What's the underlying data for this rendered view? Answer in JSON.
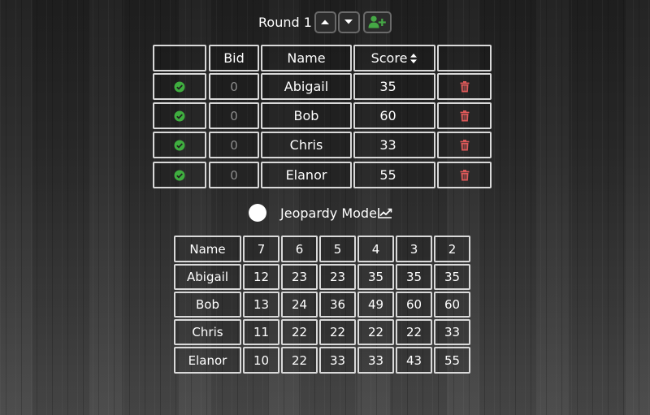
{
  "round": {
    "label": "Round 1"
  },
  "players_table": {
    "headers": {
      "check": "",
      "bid": "Bid",
      "name": "Name",
      "score": "Score",
      "delete": ""
    },
    "rows": [
      {
        "bid": "0",
        "name": "Abigail",
        "score": "35"
      },
      {
        "bid": "0",
        "name": "Bob",
        "score": "60"
      },
      {
        "bid": "0",
        "name": "Chris",
        "score": "33"
      },
      {
        "bid": "0",
        "name": "Elanor",
        "score": "55"
      }
    ]
  },
  "jeopardy": {
    "label": "Jeopardy Mode",
    "enabled": false
  },
  "history_table": {
    "headers": [
      "Name",
      "7",
      "6",
      "5",
      "4",
      "3",
      "2"
    ],
    "rows": [
      {
        "name": "Abigail",
        "values": [
          "12",
          "23",
          "23",
          "35",
          "35",
          "35"
        ]
      },
      {
        "name": "Bob",
        "values": [
          "13",
          "24",
          "36",
          "49",
          "60",
          "60"
        ]
      },
      {
        "name": "Chris",
        "values": [
          "11",
          "22",
          "22",
          "22",
          "22",
          "33"
        ]
      },
      {
        "name": "Elanor",
        "values": [
          "10",
          "22",
          "33",
          "33",
          "43",
          "55"
        ]
      }
    ]
  },
  "colors": {
    "check": "#3fae3f",
    "trash": "#e05a5a",
    "add_user": "#45a845",
    "border": "#d9d9d9",
    "bid_text": "#8c8c8c"
  },
  "icons": {
    "up": "caret-up-icon",
    "down": "caret-down-icon",
    "add_user": "user-plus-icon",
    "sort": "sort-icon",
    "check": "check-circle-icon",
    "trash": "trash-icon",
    "chart": "line-chart-icon"
  }
}
